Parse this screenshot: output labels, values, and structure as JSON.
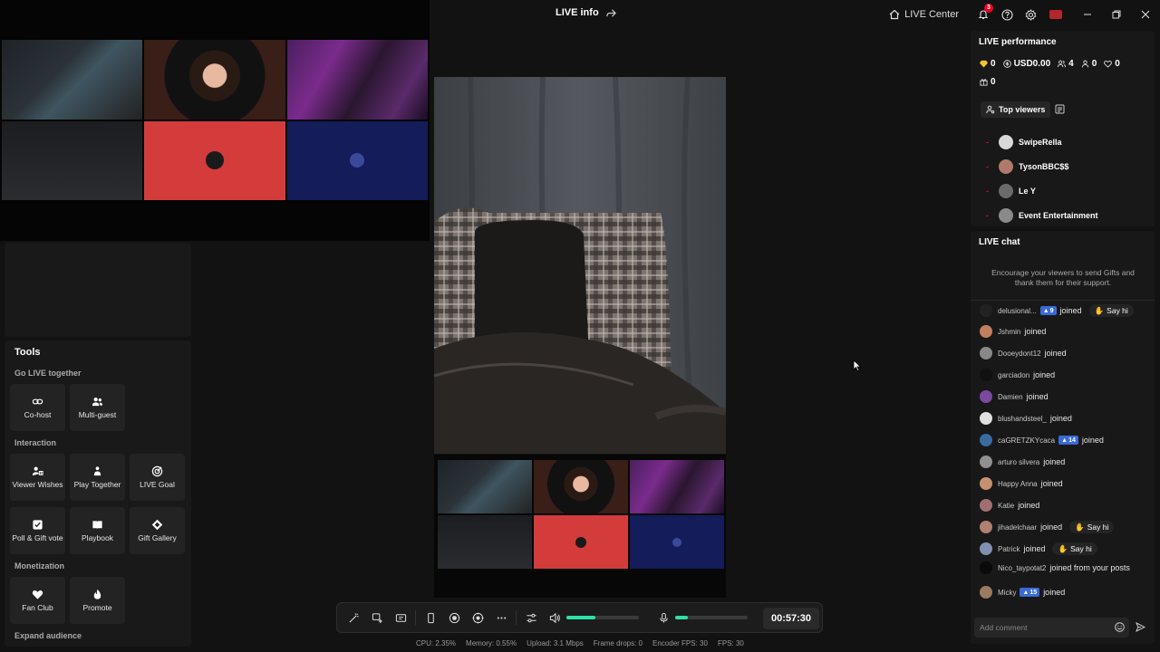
{
  "header": {
    "title": "LIVE info",
    "live_center": "LIVE Center",
    "notification_count": "3"
  },
  "tools": {
    "title": "Tools",
    "sections": {
      "go_live_together": "Go LIVE together",
      "interaction": "Interaction",
      "monetization": "Monetization",
      "expand_audience": "Expand audience"
    },
    "cohost": "Co-host",
    "multiguest": "Multi-guest",
    "viewer_wishes": "Viewer Wishes",
    "play_together": "Play Together",
    "live_goal": "LIVE Goal",
    "poll_gift_vote": "Poll & Gift vote",
    "playbook": "Playbook",
    "gift_gallery": "Gift Gallery",
    "fan_club": "Fan Club",
    "promote": "Promote"
  },
  "controls": {
    "timer": "00:57:30",
    "volume_level": 0.4,
    "mic_level": 0.18
  },
  "stats": {
    "cpu": "CPU:  2.35%",
    "memory": "Memory:  0.55%",
    "upload": "Upload:  3.1 Mbps",
    "frame_drops": "Frame drops:  0",
    "encoder_fps": "Encoder FPS:  30",
    "fps": "FPS:  30"
  },
  "performance": {
    "title": "LIVE performance",
    "diamonds": "0",
    "usd": "USD0.00",
    "viewers": "4",
    "new_followers": "0",
    "likes": "0",
    "gifts": "0",
    "top_viewers_tab": "Top viewers",
    "top_viewers": [
      {
        "rank": "-",
        "name": "SwipeRella",
        "color": "#d8d8d8"
      },
      {
        "rank": "-",
        "name": "TysonBBC$$",
        "color": "#b07a6a"
      },
      {
        "rank": "-",
        "name": "Le Y",
        "color": "#6a6a6a"
      },
      {
        "rank": "-",
        "name": "Event Entertainment",
        "color": "#8a8a8a"
      }
    ]
  },
  "chat": {
    "title": "LIVE chat",
    "hint": "Encourage your viewers to send Gifts and thank them for their support.",
    "say_hi": "Say hi",
    "placeholder": "Add comment",
    "messages": [
      {
        "user": "delusional...",
        "level": "9",
        "text": "joined",
        "say_hi": true,
        "color": "#222"
      },
      {
        "user": "Jshmin",
        "text": "joined",
        "color": "#c08060"
      },
      {
        "user": "Dooeydont12",
        "text": "joined",
        "color": "#888"
      },
      {
        "user": "garciadon",
        "text": "joined",
        "color": "#111"
      },
      {
        "user": "Damien",
        "text": "joined",
        "color": "#7a4aa0"
      },
      {
        "user": "blushandsteel_",
        "text": "joined",
        "color": "#e0e0e0"
      },
      {
        "user": "caGRETZKYcaca",
        "level": "14",
        "text": "joined",
        "color": "#3a6aa0"
      },
      {
        "user": "arturo silvera",
        "text": "joined",
        "color": "#909090"
      },
      {
        "user": "Happy Anna",
        "text": "joined",
        "color": "#c89070"
      },
      {
        "user": "Katie",
        "text": "joined",
        "color": "#a07070"
      },
      {
        "user": "jihadelchaar",
        "text": "joined",
        "say_hi": true,
        "color": "#b08070"
      },
      {
        "user": "Patrick",
        "text": "joined",
        "say_hi": true,
        "color": "#8090b0"
      },
      {
        "user": "Nico_taypotat2",
        "text": "joined from your posts",
        "color": "#0a0a0a"
      },
      {
        "user": "Micky",
        "level": "15",
        "text": "joined",
        "color": "#9a7a60"
      }
    ]
  }
}
